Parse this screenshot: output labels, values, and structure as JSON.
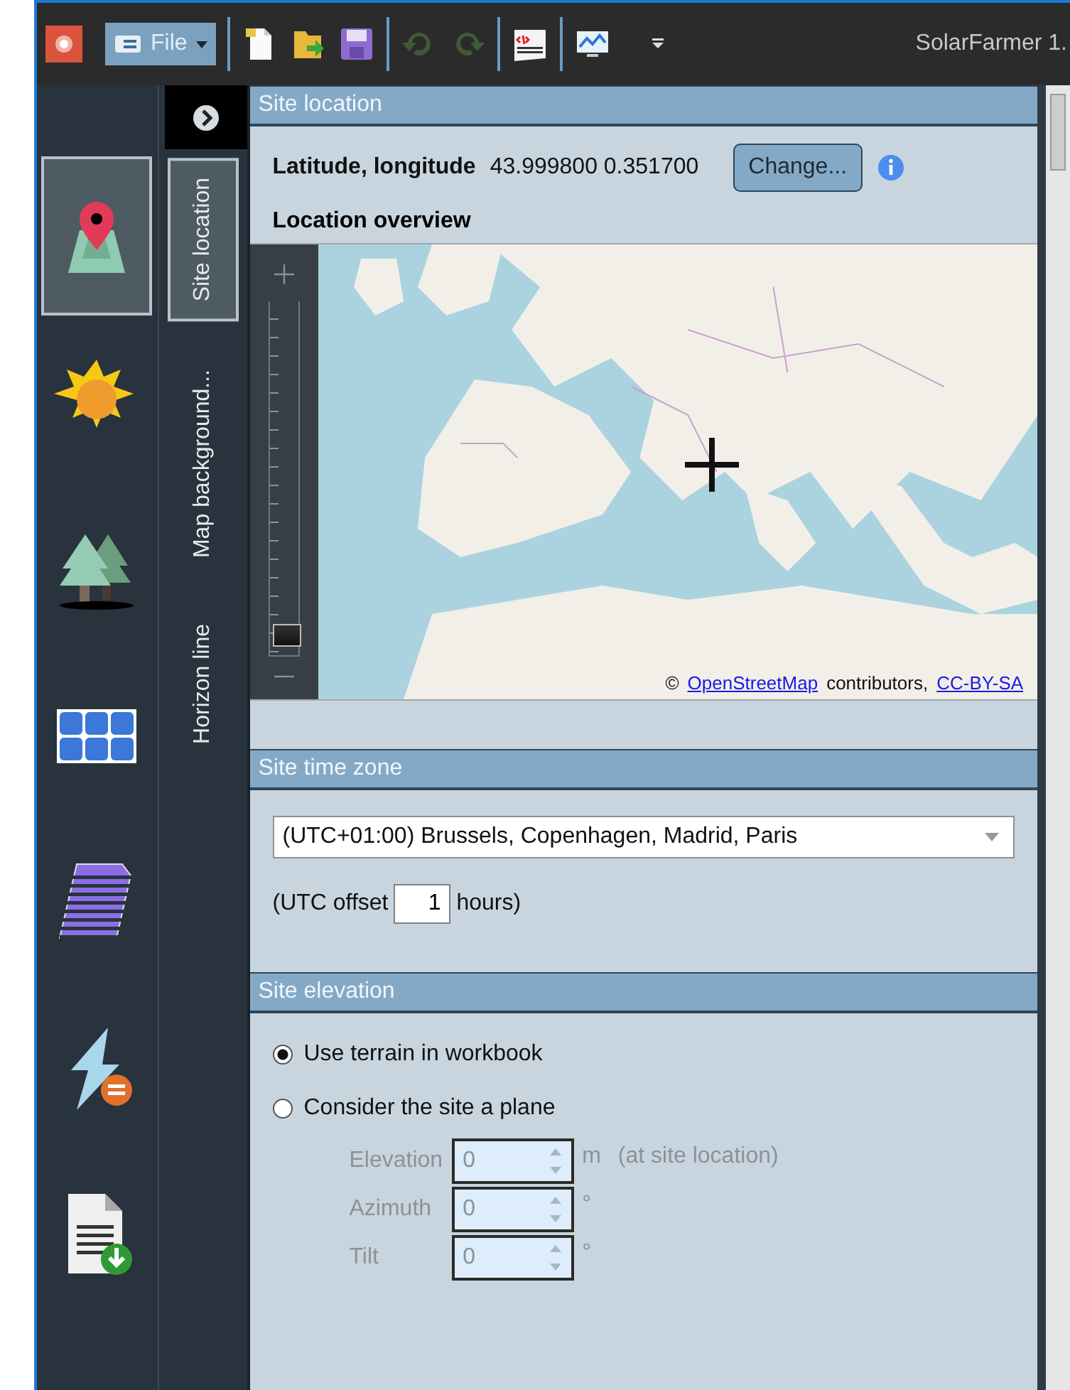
{
  "title_bar": {
    "file_menu": {
      "label": "File"
    },
    "toolbar": [
      {
        "kind": "new",
        "disabled": false
      },
      {
        "kind": "open",
        "disabled": false
      },
      {
        "kind": "save",
        "disabled": false
      },
      {
        "kind": "undo",
        "disabled": true
      },
      {
        "kind": "redo",
        "disabled": true
      },
      {
        "kind": "code",
        "disabled": false
      },
      {
        "kind": "monitor",
        "disabled": false
      }
    ],
    "title": "SolarFarmer 1."
  },
  "nav_rail": [
    {
      "kind": "location",
      "selected": true
    },
    {
      "kind": "sun",
      "selected": false
    },
    {
      "kind": "trees",
      "selected": false
    },
    {
      "kind": "panels",
      "selected": false
    },
    {
      "kind": "array",
      "selected": false
    },
    {
      "kind": "energy",
      "selected": false
    },
    {
      "kind": "report",
      "selected": false
    }
  ],
  "side_tabs": [
    {
      "label": "Site location",
      "selected": true
    },
    {
      "label": "Map background...",
      "selected": false
    },
    {
      "label": "Horizon line",
      "selected": false
    }
  ],
  "site_location": {
    "header": "Site location",
    "coords_label": "Latitude, longitude",
    "coords_value": "43.999800 0.351700",
    "change_button": "Change...",
    "overview_label": "Location overview",
    "map": {
      "kind": "picture",
      "zoom": {
        "level": 0.03
      },
      "attribution": {
        "symbol": "©",
        "link": "OpenStreetMap",
        "text": "contributors,",
        "license": "CC-BY-SA"
      }
    }
  },
  "time_zone": {
    "header": "Site time zone",
    "value": "(UTC+01:00) Brussels, Copenhagen, Madrid, Paris",
    "offset_label": "(UTC offset",
    "offset_value": "1",
    "offset_unit": "hours)"
  },
  "elevation": {
    "header": "Site elevation",
    "options": [
      {
        "label": "Use terrain in workbook",
        "selected": true
      },
      {
        "label": "Consider the site a plane",
        "selected": false
      }
    ],
    "fields": [
      {
        "label": "Elevation",
        "value": "0",
        "unit": "m",
        "note": "(at site location)",
        "disabled": true
      },
      {
        "label": "Azimuth",
        "value": "0",
        "unit": "°",
        "disabled": true
      },
      {
        "label": "Tilt",
        "value": "0",
        "unit": "°",
        "disabled": true
      }
    ]
  }
}
